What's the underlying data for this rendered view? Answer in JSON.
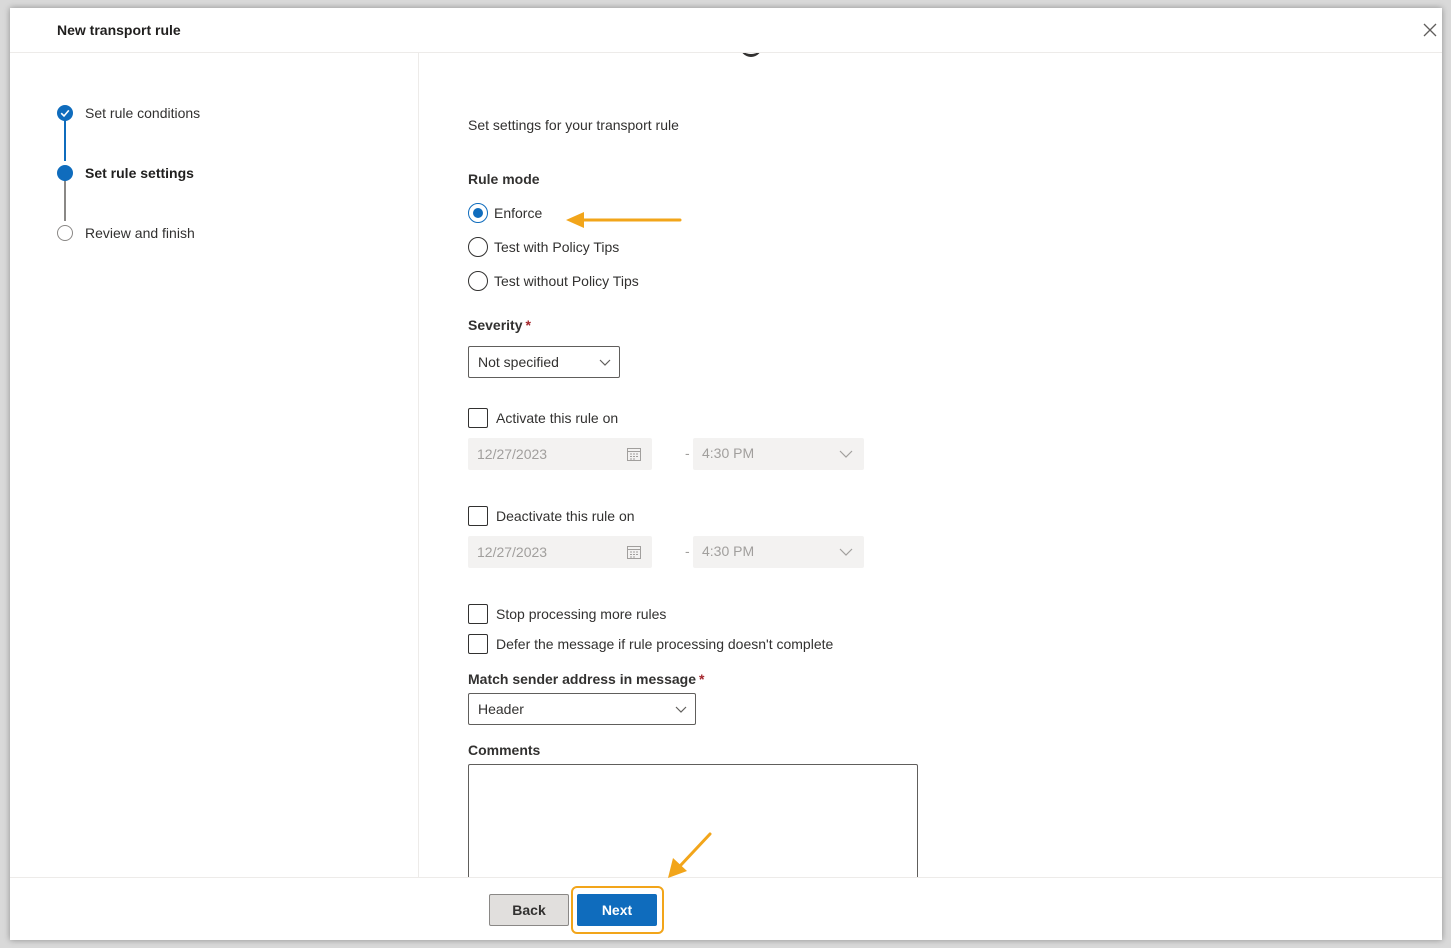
{
  "panel": {
    "title": "New transport rule",
    "close_icon": "close-icon"
  },
  "steps": [
    {
      "label": "Set rule conditions",
      "state": "completed"
    },
    {
      "label": "Set rule settings",
      "state": "current"
    },
    {
      "label": "Review and finish",
      "state": "not-started"
    }
  ],
  "main": {
    "description": "Set settings for your transport rule",
    "rule_mode": {
      "label": "Rule mode",
      "options": [
        "Enforce",
        "Test with Policy Tips",
        "Test without Policy Tips"
      ],
      "selected": "Enforce"
    },
    "severity": {
      "label": "Severity",
      "required_mark": "*",
      "value": "Not specified"
    },
    "activate": {
      "label": "Activate this rule on",
      "checked": false,
      "date": "12/27/2023",
      "separator": "-",
      "time": "4:30 PM"
    },
    "deactivate": {
      "label": "Deactivate this rule on",
      "checked": false,
      "date": "12/27/2023",
      "separator": "-",
      "time": "4:30 PM"
    },
    "stop_processing": {
      "label": "Stop processing more rules",
      "checked": false
    },
    "defer": {
      "label": "Defer the message if rule processing doesn't complete",
      "checked": false
    },
    "match_sender": {
      "label": "Match sender address in message",
      "required_mark": "*",
      "value": "Header"
    },
    "comments": {
      "label": "Comments",
      "value": ""
    }
  },
  "footer": {
    "back_label": "Back",
    "next_label": "Next"
  },
  "colors": {
    "accent": "#0f6cbd",
    "highlight": "#f2a51a",
    "required": "#a4262c"
  }
}
